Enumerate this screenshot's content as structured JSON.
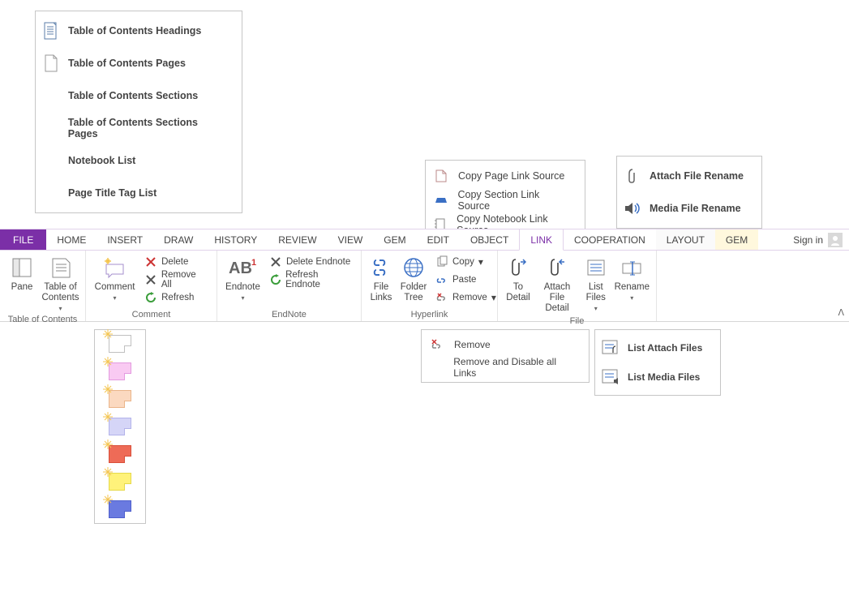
{
  "menus": {
    "toc": {
      "items": [
        {
          "label": "Table of Contents Headings"
        },
        {
          "label": "Table of Contents Pages"
        },
        {
          "label": "Table of Contents Sections"
        },
        {
          "label": "Table of Contents Sections Pages"
        },
        {
          "label": "Notebook List"
        },
        {
          "label": "Page Title Tag List"
        }
      ]
    },
    "copy_source": {
      "items": [
        {
          "label": "Copy Page Link Source"
        },
        {
          "label": "Copy Section Link Source"
        },
        {
          "label": "Copy Notebook Link Source"
        }
      ]
    },
    "rename": {
      "items": [
        {
          "label": "Attach File Rename"
        },
        {
          "label": "Media File Rename"
        }
      ]
    },
    "remove_links": {
      "items": [
        {
          "label": "Remove"
        },
        {
          "label": "Remove and Disable all Links"
        }
      ]
    },
    "list_files": {
      "items": [
        {
          "label": "List Attach Files"
        },
        {
          "label": "List Media Files"
        }
      ]
    }
  },
  "tabs": {
    "file": "FILE",
    "list": [
      "HOME",
      "INSERT",
      "DRAW",
      "HISTORY",
      "REVIEW",
      "VIEW",
      "GEM",
      "EDIT",
      "OBJECT",
      "LINK",
      "COOPERATION",
      "LAYOUT",
      "GEM"
    ],
    "active": "LINK",
    "signin": "Sign in"
  },
  "ribbon": {
    "groups": {
      "toc": {
        "label": "Table of Contents",
        "pane": "Pane",
        "table_of_contents": "Table of\nContents"
      },
      "comment": {
        "label": "Comment",
        "comment": "Comment",
        "delete": "Delete",
        "remove_all": "Remove All",
        "refresh": "Refresh"
      },
      "endnote": {
        "label": "EndNote",
        "endnote": "Endnote",
        "delete": "Delete Endnote",
        "refresh": "Refresh Endnote"
      },
      "hyperlink": {
        "label": "Hyperlink",
        "file_links": "File\nLinks",
        "folder_tree": "Folder\nTree",
        "copy": "Copy",
        "paste": "Paste",
        "remove": "Remove"
      },
      "file": {
        "label": "File",
        "to_detail": "To\nDetail",
        "attach_detail": "Attach\nFile Detail",
        "list_files": "List\nFiles",
        "rename": "Rename"
      }
    }
  },
  "swatches": [
    {
      "fill": "#ffffff",
      "border": "#c0c0c0"
    },
    {
      "fill": "#f9caf2",
      "border": "#e39adf"
    },
    {
      "fill": "#fbd9c0",
      "border": "#eab58a"
    },
    {
      "fill": "#d5d5f7",
      "border": "#b3b3ea"
    },
    {
      "fill": "#ee6b57",
      "border": "#d94f3a"
    },
    {
      "fill": "#fff27a",
      "border": "#e6d94a"
    },
    {
      "fill": "#6a7ae0",
      "border": "#4f60cd"
    }
  ]
}
